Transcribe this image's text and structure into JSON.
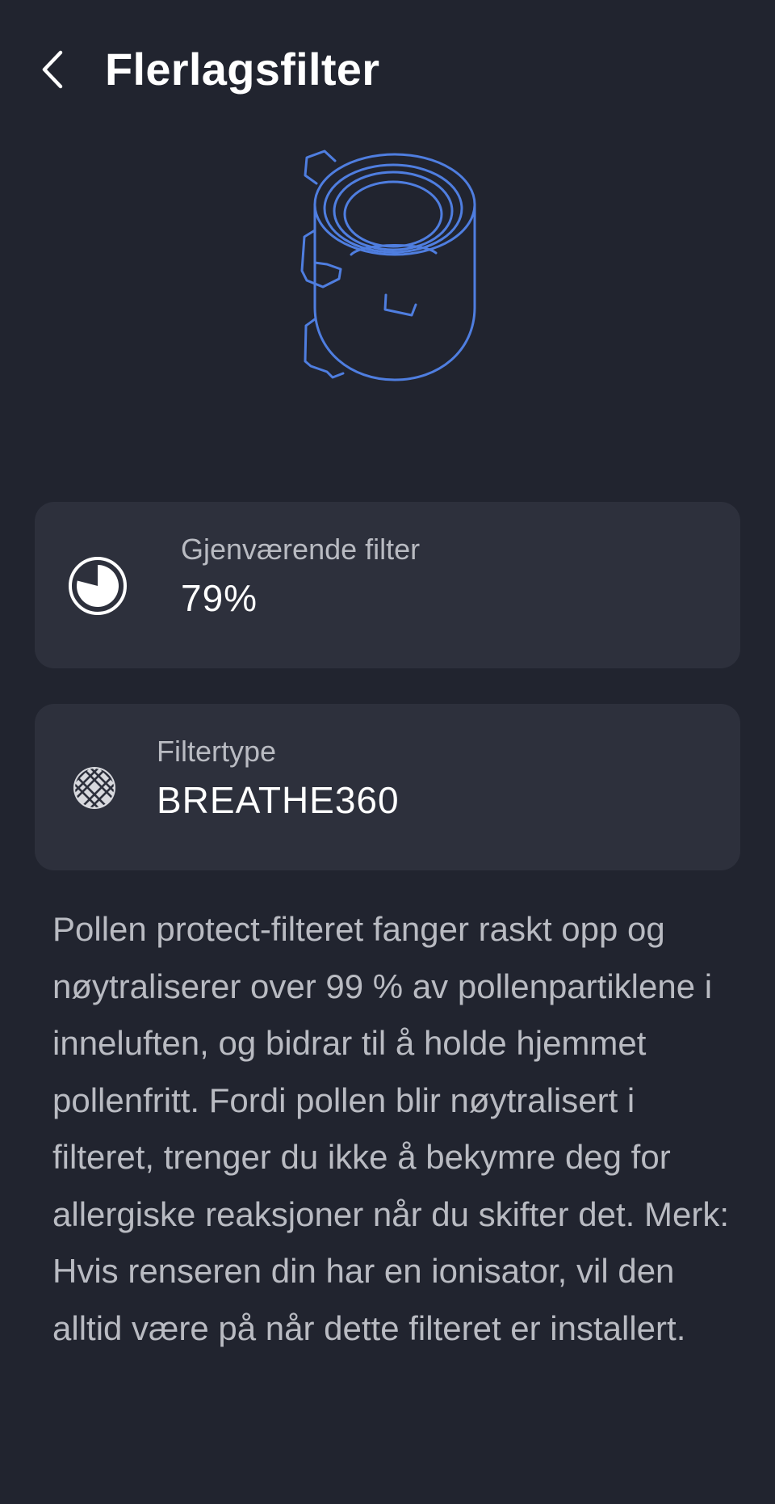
{
  "header": {
    "back_icon": "chevron-left-icon",
    "title": "Flerlagsfilter"
  },
  "illustration": {
    "icon": "cylindrical-filter-illustration",
    "stroke_color": "#4f7ee0"
  },
  "remaining_filter": {
    "icon": "filter-life-gauge-icon",
    "label": "Gjenværende filter",
    "value": "79%",
    "percent": 79
  },
  "filter_type": {
    "icon": "mesh-filter-icon",
    "label": "Filtertype",
    "value": "BREATHE360"
  },
  "description": "Pollen protect-filteret fanger raskt opp og nøytraliserer over 99 % av pollenpartiklene i inneluften, og bidrar til å holde hjemmet pollenfritt. Fordi pollen blir nøytralisert i filteret, trenger du ikke å bekymre deg for allergiske reaksjoner når du skifter det. Merk: Hvis renseren din har en ionisator, vil den alltid være på når dette filteret er installert.",
  "colors": {
    "background": "#21242f",
    "card": "#2d303c",
    "text_primary": "#ffffff",
    "text_secondary": "#b9bbc2",
    "accent": "#4f7ee0"
  }
}
